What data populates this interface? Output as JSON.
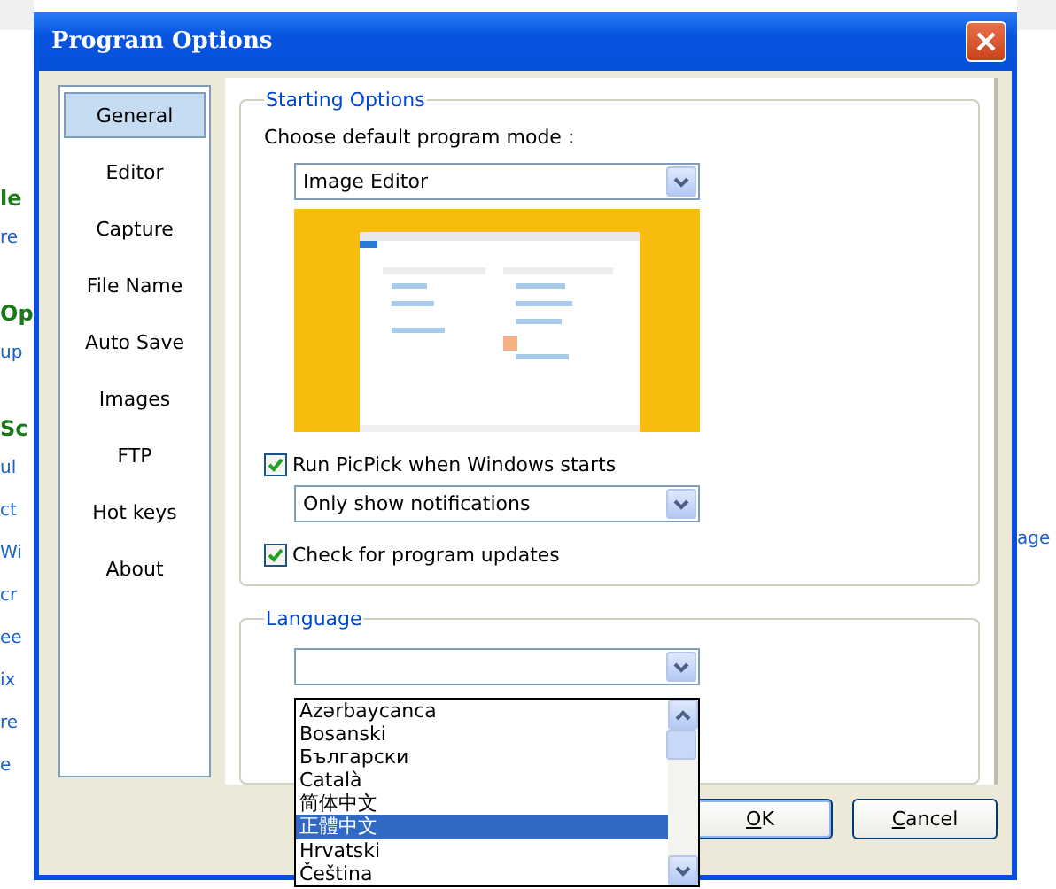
{
  "background_page": {
    "sections": [
      {
        "heading": "le",
        "links": [
          "re"
        ]
      },
      {
        "heading": "Op",
        "links": [
          "up"
        ]
      },
      {
        "heading": "Sc",
        "links": [
          "ul",
          "ct",
          "Wi",
          "cr",
          "ee",
          "ix",
          "re",
          "e"
        ]
      }
    ],
    "right_link": "age"
  },
  "window": {
    "title": "Program Options"
  },
  "sidebar": {
    "items": [
      {
        "label": "General",
        "selected": true
      },
      {
        "label": "Editor",
        "selected": false
      },
      {
        "label": "Capture",
        "selected": false
      },
      {
        "label": "File Name",
        "selected": false
      },
      {
        "label": "Auto Save",
        "selected": false
      },
      {
        "label": "Images",
        "selected": false
      },
      {
        "label": "FTP",
        "selected": false
      },
      {
        "label": "Hot keys",
        "selected": false
      },
      {
        "label": "About",
        "selected": false
      }
    ]
  },
  "starting_options": {
    "title": "Starting Options",
    "mode_label": "Choose default program mode :",
    "mode_value": "Image Editor",
    "run_at_startup": {
      "label": "Run PicPick when Windows starts",
      "checked": true
    },
    "startup_value": "Only show notifications",
    "check_updates": {
      "label": "Check for program updates",
      "checked": true
    }
  },
  "language": {
    "title": "Language",
    "list_open": true,
    "options": [
      {
        "label": "Azərbaycanca",
        "selected": false
      },
      {
        "label": "Bosanski",
        "selected": false
      },
      {
        "label": "Български",
        "selected": false
      },
      {
        "label": "Català",
        "selected": false
      },
      {
        "label": "简体中文",
        "selected": false
      },
      {
        "label": "正體中文",
        "selected": true
      },
      {
        "label": "Hrvatski",
        "selected": false
      },
      {
        "label": "Čeština",
        "selected": false
      }
    ]
  },
  "buttons": [
    {
      "mnemonic": "O",
      "label_rest": "K",
      "default": true
    },
    {
      "mnemonic": "C",
      "label_rest": "ancel",
      "default": false
    }
  ]
}
